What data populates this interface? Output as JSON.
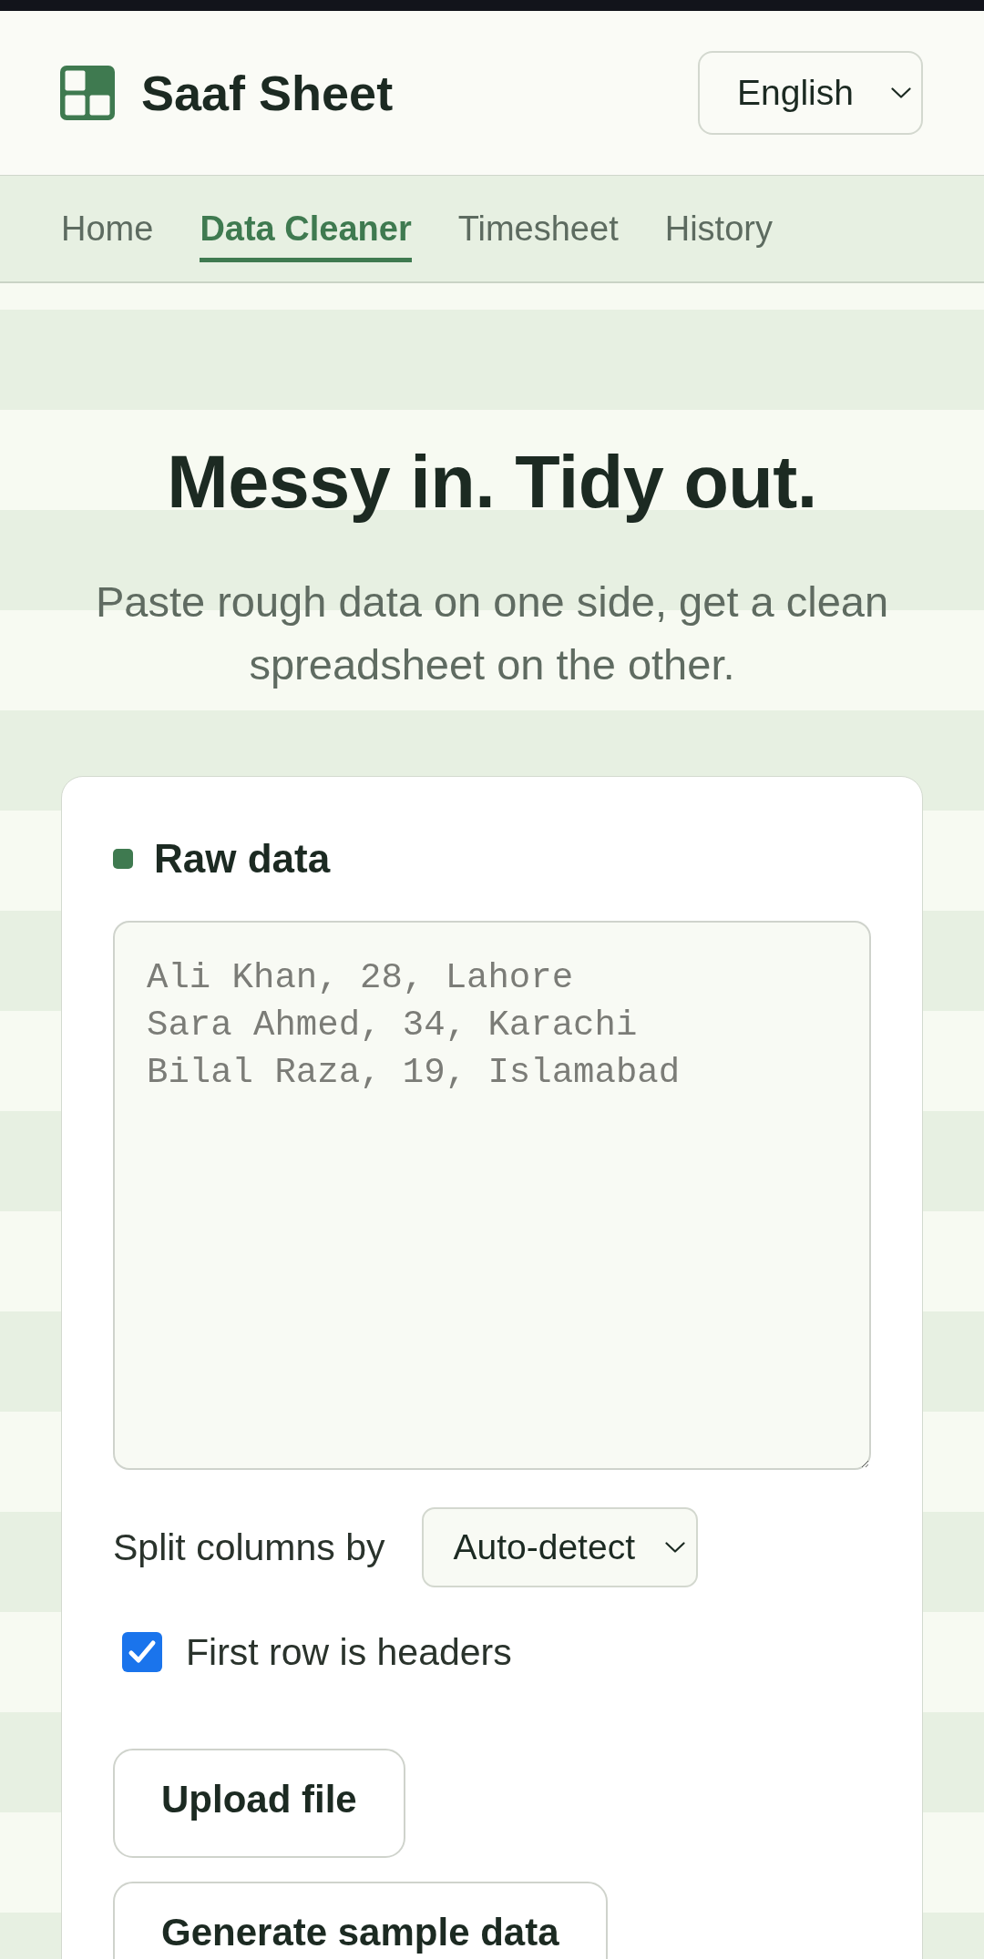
{
  "header": {
    "title": "Saaf Sheet",
    "language_select": {
      "value": "English"
    }
  },
  "nav": {
    "items": [
      {
        "label": "Home",
        "selected": false
      },
      {
        "label": "Data Cleaner",
        "selected": true
      },
      {
        "label": "Timesheet",
        "selected": false
      },
      {
        "label": "History",
        "selected": false
      }
    ]
  },
  "hero": {
    "title": "Messy in. Tidy out.",
    "subtitle": "Paste rough data on one side, get a clean spreadsheet on the other."
  },
  "raw_data_card": {
    "title": "Raw data",
    "input": {
      "placeholder": "Ali Khan, 28, Lahore\nSara Ahmed, 34, Karachi\nBilal Raza, 19, Islamabad"
    },
    "split_columns": {
      "label": "Split columns by",
      "value": "Auto-detect"
    },
    "headers_checkbox": {
      "label": "First row is headers",
      "checked": true
    },
    "buttons": [
      "Upload file",
      "Generate sample data"
    ]
  }
}
